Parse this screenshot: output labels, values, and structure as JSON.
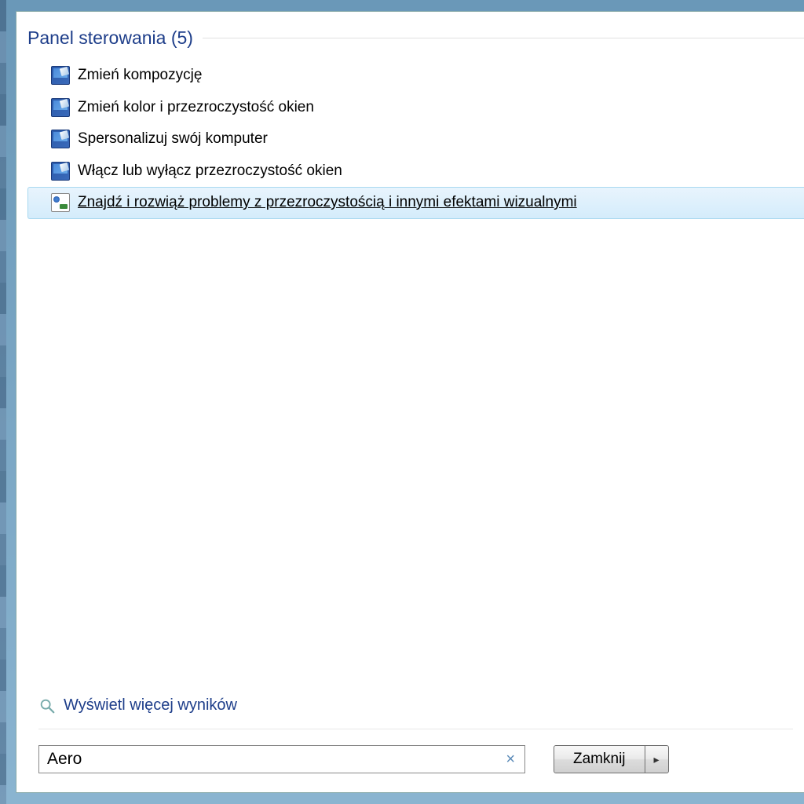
{
  "section": {
    "title": "Panel sterowania (5)"
  },
  "results": [
    {
      "label": "Zmień kompozycję",
      "icon": "monitor-icon",
      "selected": false
    },
    {
      "label": "Zmień kolor i przezroczystość okien",
      "icon": "monitor-icon",
      "selected": false
    },
    {
      "label": "Spersonalizuj swój komputer",
      "icon": "monitor-icon",
      "selected": false
    },
    {
      "label": "Włącz lub wyłącz przezroczystość okien",
      "icon": "monitor-icon",
      "selected": false
    },
    {
      "label": "Znajdź i rozwiąż problemy z przezroczystością i innymi efektami wizualnymi",
      "icon": "troubleshoot-icon",
      "selected": true
    }
  ],
  "more_results": {
    "label": "Wyświetl więcej wyników"
  },
  "search": {
    "value": "Aero",
    "clear_glyph": "×"
  },
  "close_button": {
    "label": "Zamknij",
    "arrow": "▸"
  }
}
